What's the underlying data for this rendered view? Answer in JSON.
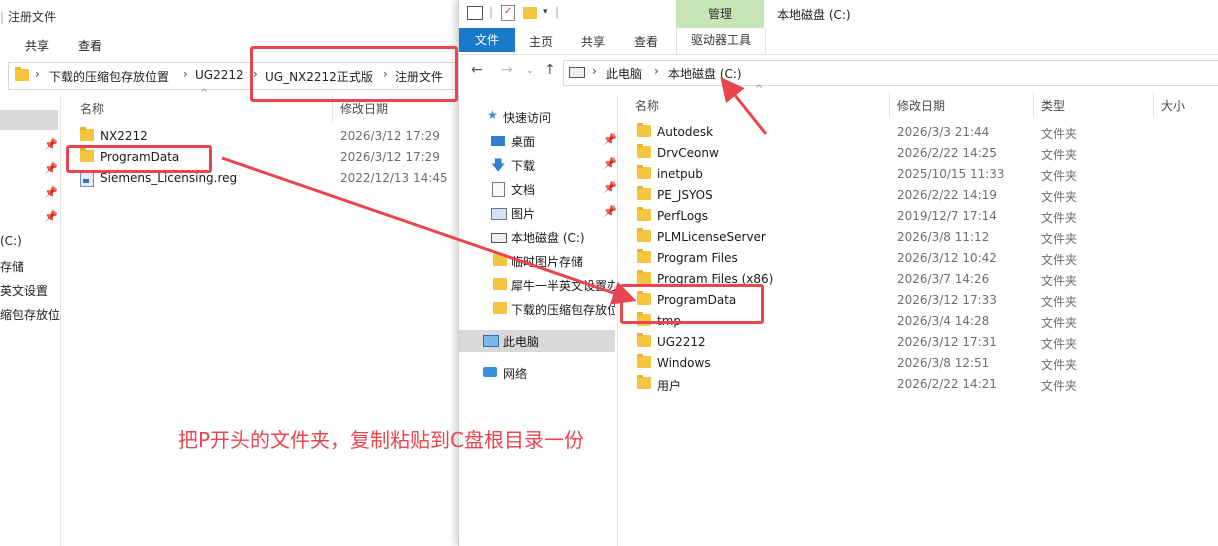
{
  "left_window": {
    "title": "注册文件",
    "ribbon_tabs": [
      "共享",
      "查看"
    ],
    "breadcrumb": [
      "下载的压缩包存放位置",
      "UG2212",
      "UG_NX2212正式版",
      "注册文件"
    ],
    "columns": {
      "name": "名称",
      "date": "修改日期"
    },
    "nav_labels": [
      "(C:)",
      "存储",
      "英文设置",
      "缩包存放位"
    ],
    "files": [
      {
        "name": "NX2212",
        "date": "2026/3/12 17:29",
        "icon": "folder-icon"
      },
      {
        "name": "ProgramData",
        "date": "2026/3/12 17:29",
        "icon": "folder-icon"
      },
      {
        "name": "Siemens_Licensing.reg",
        "date": "2022/12/13 14:45",
        "icon": "reg-file-icon"
      }
    ]
  },
  "right_window": {
    "manage_tab": "管理",
    "title": "本地磁盘 (C:)",
    "file_tab": "文件",
    "ribbon_tabs": [
      "主页",
      "共享",
      "查看"
    ],
    "drive_tools": "驱动器工具",
    "breadcrumb": [
      "此电脑",
      "本地磁盘 (C:)"
    ],
    "columns": {
      "name": "名称",
      "date": "修改日期",
      "type": "类型",
      "size": "大小"
    },
    "nav": [
      {
        "label": "快速访问",
        "icon": "star-icon",
        "pinned": false
      },
      {
        "label": "桌面",
        "icon": "desktop-icon",
        "pinned": true
      },
      {
        "label": "下载",
        "icon": "download-icon",
        "pinned": true
      },
      {
        "label": "文档",
        "icon": "document-icon",
        "pinned": true
      },
      {
        "label": "图片",
        "icon": "picture-icon",
        "pinned": true
      },
      {
        "label": "本地磁盘 (C:)",
        "icon": "drive-icon",
        "pinned": false
      },
      {
        "label": "临时图片存储",
        "icon": "folder-icon",
        "pinned": false
      },
      {
        "label": "犀牛一半英文设置办",
        "icon": "folder-icon",
        "pinned": false
      },
      {
        "label": "下载的压缩包存放位",
        "icon": "folder-icon",
        "pinned": false
      },
      {
        "label": "此电脑",
        "icon": "computer-icon",
        "pinned": false
      },
      {
        "label": "网络",
        "icon": "network-icon",
        "pinned": false
      }
    ],
    "files": [
      {
        "name": "Autodesk",
        "date": "2026/3/3 21:44",
        "type": "文件夹"
      },
      {
        "name": "DrvCeonw",
        "date": "2026/2/22 14:25",
        "type": "文件夹"
      },
      {
        "name": "inetpub",
        "date": "2025/10/15 11:33",
        "type": "文件夹"
      },
      {
        "name": "PE_JSYOS",
        "date": "2026/2/22 14:19",
        "type": "文件夹"
      },
      {
        "name": "PerfLogs",
        "date": "2019/12/7 17:14",
        "type": "文件夹"
      },
      {
        "name": "PLMLicenseServer",
        "date": "2026/3/8 11:12",
        "type": "文件夹"
      },
      {
        "name": "Program Files",
        "date": "2026/3/12 10:42",
        "type": "文件夹"
      },
      {
        "name": "Program Files (x86)",
        "date": "2026/3/7 14:26",
        "type": "文件夹"
      },
      {
        "name": "ProgramData",
        "date": "2026/3/12 17:33",
        "type": "文件夹"
      },
      {
        "name": "tmp",
        "date": "2026/3/4 14:28",
        "type": "文件夹"
      },
      {
        "name": "UG2212",
        "date": "2026/3/12 17:31",
        "type": "文件夹"
      },
      {
        "name": "Windows",
        "date": "2026/3/8 12:51",
        "type": "文件夹"
      },
      {
        "name": "用户",
        "date": "2026/2/22 14:21",
        "type": "文件夹"
      }
    ]
  },
  "annotation": {
    "instruction": "把P开头的文件夹，复制粘贴到C盘根目录一份",
    "color": "#e8454f"
  }
}
